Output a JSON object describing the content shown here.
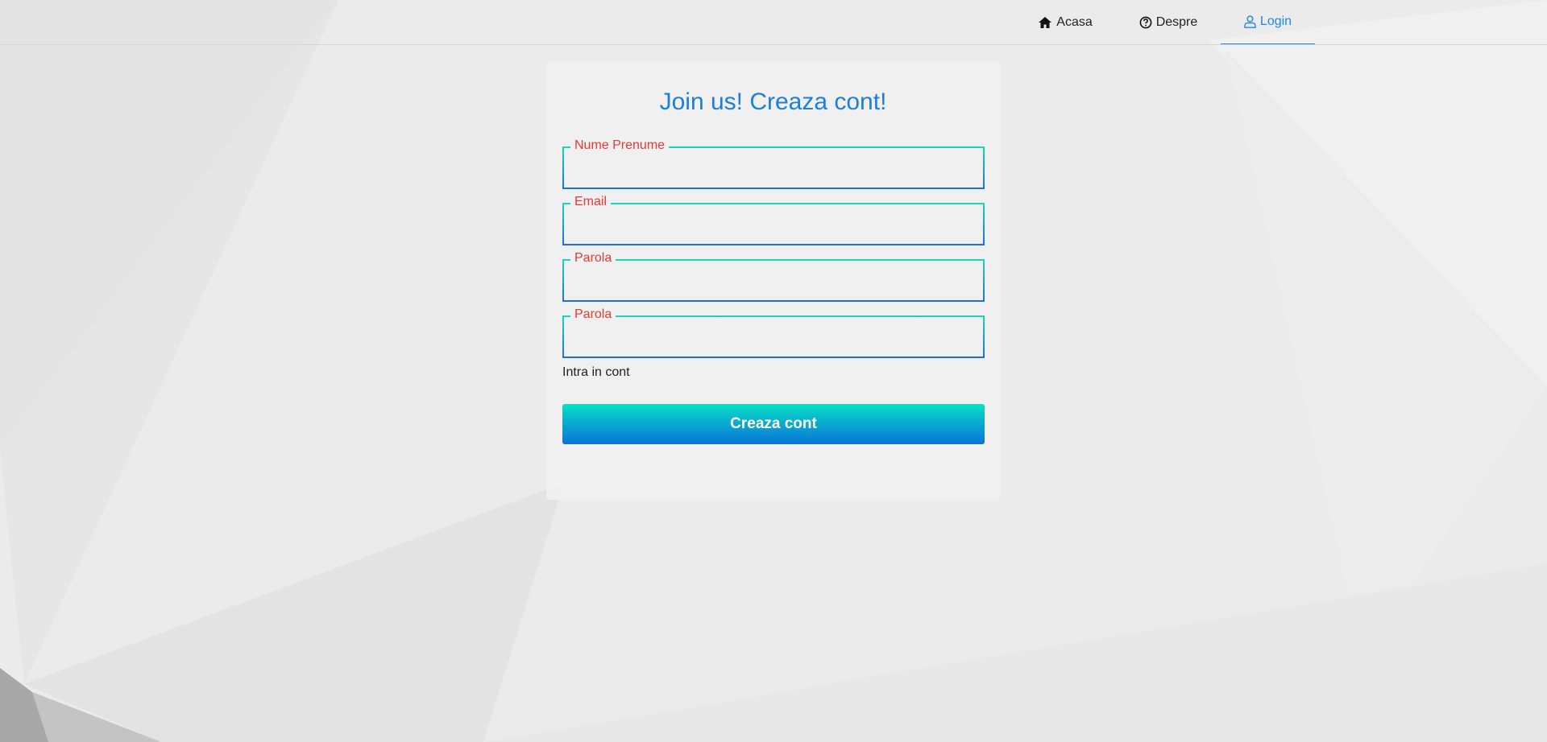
{
  "nav": {
    "items": [
      {
        "label": "Acasa",
        "icon": "home-icon",
        "active": false
      },
      {
        "label": "Despre",
        "icon": "question-circle-icon",
        "active": false
      },
      {
        "label": "Login",
        "icon": "user-icon",
        "active": true
      }
    ]
  },
  "form": {
    "title": "Join us! Creaza cont!",
    "fields": [
      {
        "label": "Nume Prenume",
        "value": ""
      },
      {
        "label": "Email",
        "value": ""
      },
      {
        "label": "Parola",
        "value": ""
      },
      {
        "label": "Parola",
        "value": ""
      }
    ],
    "login_link": "Intra in cont",
    "submit_label": "Creaza cont"
  },
  "colors": {
    "accent": "#1e88e5",
    "label": "#e53935",
    "button_top": "#08e0c6",
    "button_bottom": "#0a72d8"
  }
}
